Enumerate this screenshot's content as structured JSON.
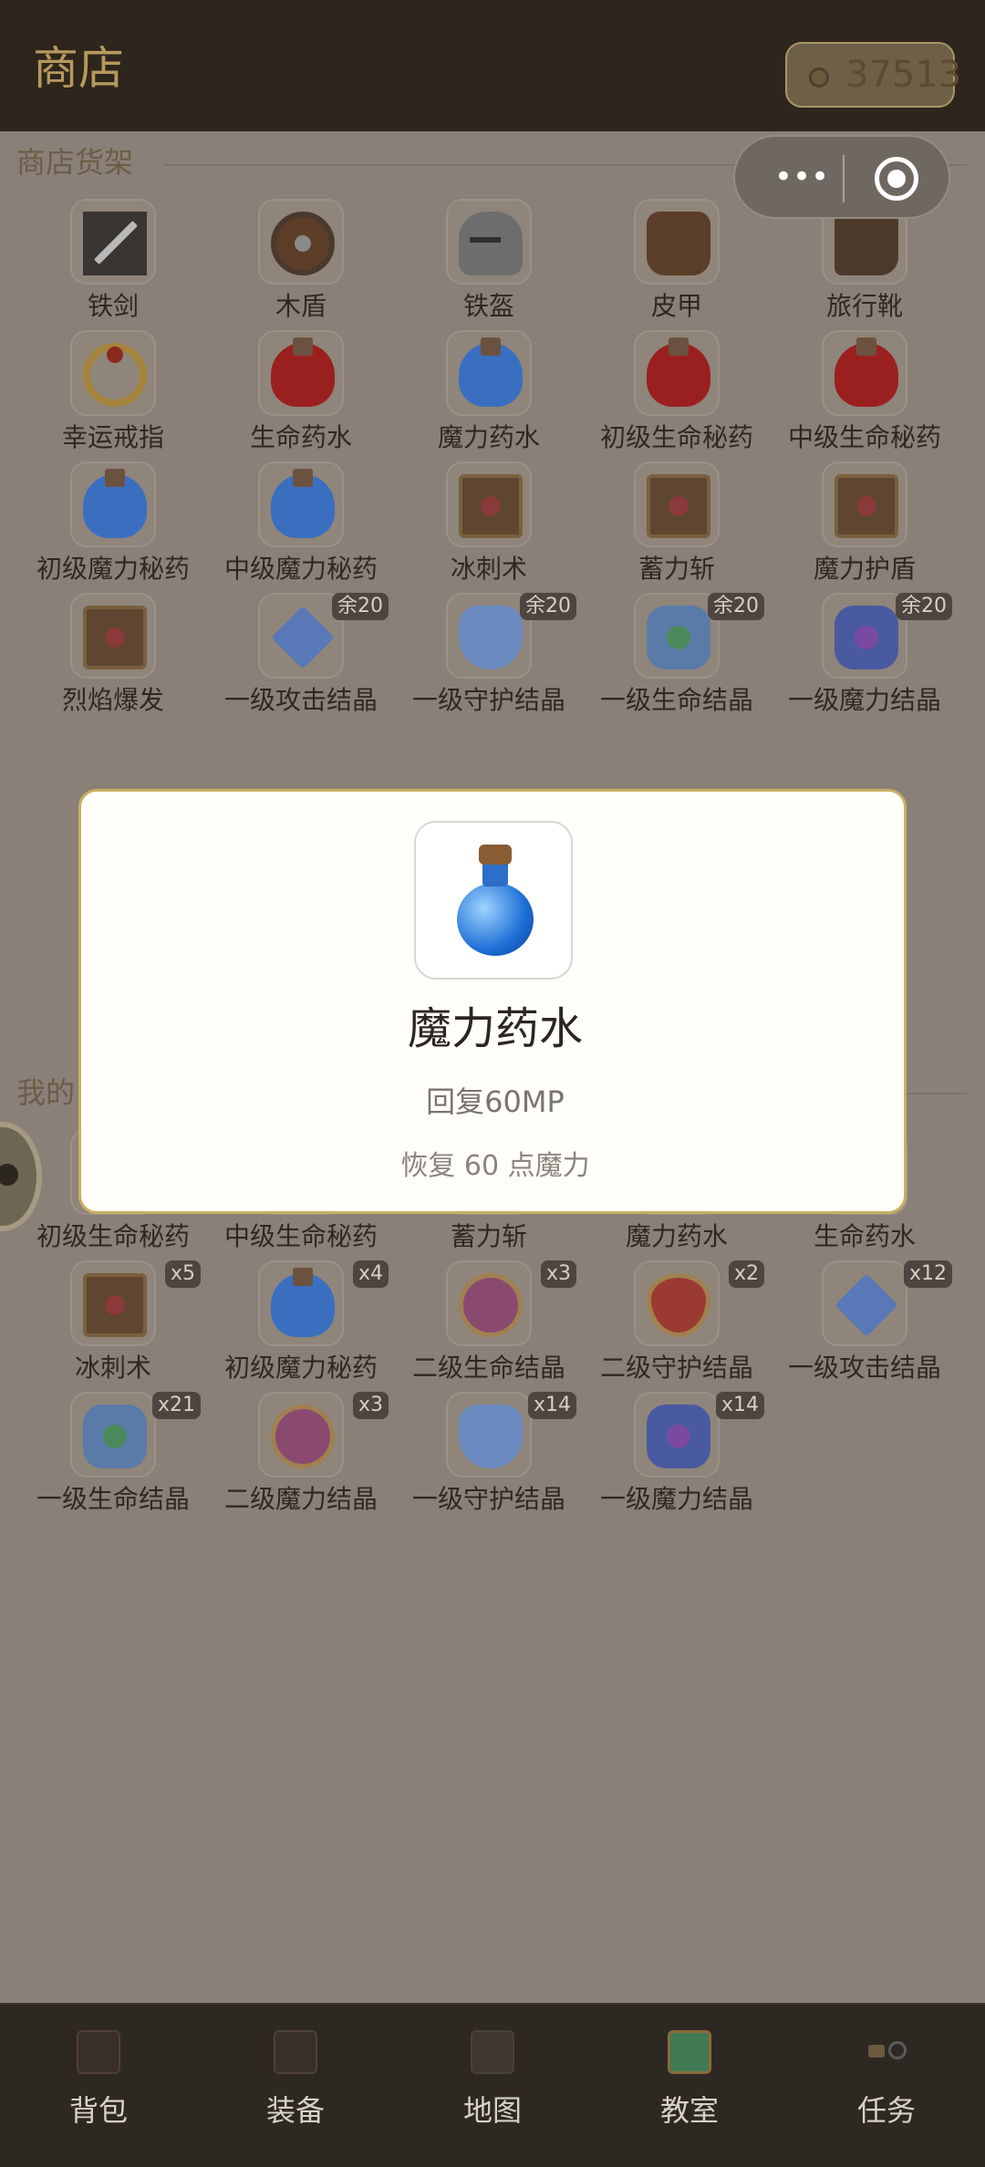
{
  "header": {
    "title": "商店",
    "coins": "37513"
  },
  "capsule": {
    "menu_icon": "•••"
  },
  "shop": {
    "title": "商店货架",
    "items": [
      {
        "label": "铁剑",
        "icon": "sword-icon",
        "badge": ""
      },
      {
        "label": "木盾",
        "icon": "wood-shield-icon",
        "badge": ""
      },
      {
        "label": "铁盔",
        "icon": "iron-helmet-icon",
        "badge": ""
      },
      {
        "label": "皮甲",
        "icon": "leather-armor-icon",
        "badge": ""
      },
      {
        "label": "旅行靴",
        "icon": "boots-icon",
        "badge": ""
      },
      {
        "label": "幸运戒指",
        "icon": "ring-icon",
        "badge": ""
      },
      {
        "label": "生命药水",
        "icon": "red-potion-icon",
        "badge": ""
      },
      {
        "label": "魔力药水",
        "icon": "blue-potion-icon",
        "badge": ""
      },
      {
        "label": "初级生命秘药",
        "icon": "red-potion-icon",
        "badge": ""
      },
      {
        "label": "中级生命秘药",
        "icon": "red-potion-icon",
        "badge": ""
      },
      {
        "label": "初级魔力秘药",
        "icon": "blue-potion-icon",
        "badge": ""
      },
      {
        "label": "中级魔力秘药",
        "icon": "blue-potion-icon",
        "badge": ""
      },
      {
        "label": "冰刺术",
        "icon": "spellbook-icon",
        "badge": ""
      },
      {
        "label": "蓄力斩",
        "icon": "spellbook-icon",
        "badge": ""
      },
      {
        "label": "魔力护盾",
        "icon": "spellbook-icon",
        "badge": ""
      },
      {
        "label": "烈焰爆发",
        "icon": "spellbook-icon",
        "badge": ""
      },
      {
        "label": "一级攻击结晶",
        "icon": "attack-crystal-icon",
        "badge": "余20"
      },
      {
        "label": "一级守护结晶",
        "icon": "guard-crystal-icon",
        "badge": "余20"
      },
      {
        "label": "一级生命结晶",
        "icon": "life-crystal-icon",
        "badge": "余20"
      },
      {
        "label": "一级魔力结晶",
        "icon": "mana-crystal-icon",
        "badge": "余20"
      }
    ]
  },
  "inventory": {
    "title": "我的",
    "items": [
      {
        "label": "初级生命秘药",
        "icon": "red-potion-icon",
        "badge": ""
      },
      {
        "label": "中级生命秘药",
        "icon": "red-potion-icon",
        "badge": ""
      },
      {
        "label": "蓄力斩",
        "icon": "spellbook-icon",
        "badge": ""
      },
      {
        "label": "魔力药水",
        "icon": "blue-potion-icon",
        "badge": ""
      },
      {
        "label": "生命药水",
        "icon": "red-potion-icon",
        "badge": ""
      },
      {
        "label": "冰刺术",
        "icon": "spellbook-icon",
        "badge": "x5"
      },
      {
        "label": "初级魔力秘药",
        "icon": "blue-potion-icon",
        "badge": "x4"
      },
      {
        "label": "二级生命结晶",
        "icon": "life-emblem-icon",
        "badge": "x3"
      },
      {
        "label": "二级守护结晶",
        "icon": "guard-emblem-icon",
        "badge": "x2"
      },
      {
        "label": "一级攻击结晶",
        "icon": "attack-crystal-icon",
        "badge": "x12"
      },
      {
        "label": "一级生命结晶",
        "icon": "life-crystal-icon",
        "badge": "x21"
      },
      {
        "label": "二级魔力结晶",
        "icon": "mana-emblem-icon",
        "badge": "x3"
      },
      {
        "label": "一级守护结晶",
        "icon": "guard-crystal-icon",
        "badge": "x14"
      },
      {
        "label": "一级魔力结晶",
        "icon": "mana-crystal-icon",
        "badge": "x14"
      }
    ]
  },
  "modal": {
    "icon": "blue-potion-icon",
    "title": "魔力药水",
    "subtitle": "回复60MP",
    "description": "恢复 60 点魔力"
  },
  "bottom_nav": [
    {
      "label": "背包",
      "icon": "bag-icon"
    },
    {
      "label": "装备",
      "icon": "equipment-icon"
    },
    {
      "label": "地图",
      "icon": "map-icon"
    },
    {
      "label": "教室",
      "icon": "classroom-icon"
    },
    {
      "label": "任务",
      "icon": "task-icon"
    }
  ]
}
